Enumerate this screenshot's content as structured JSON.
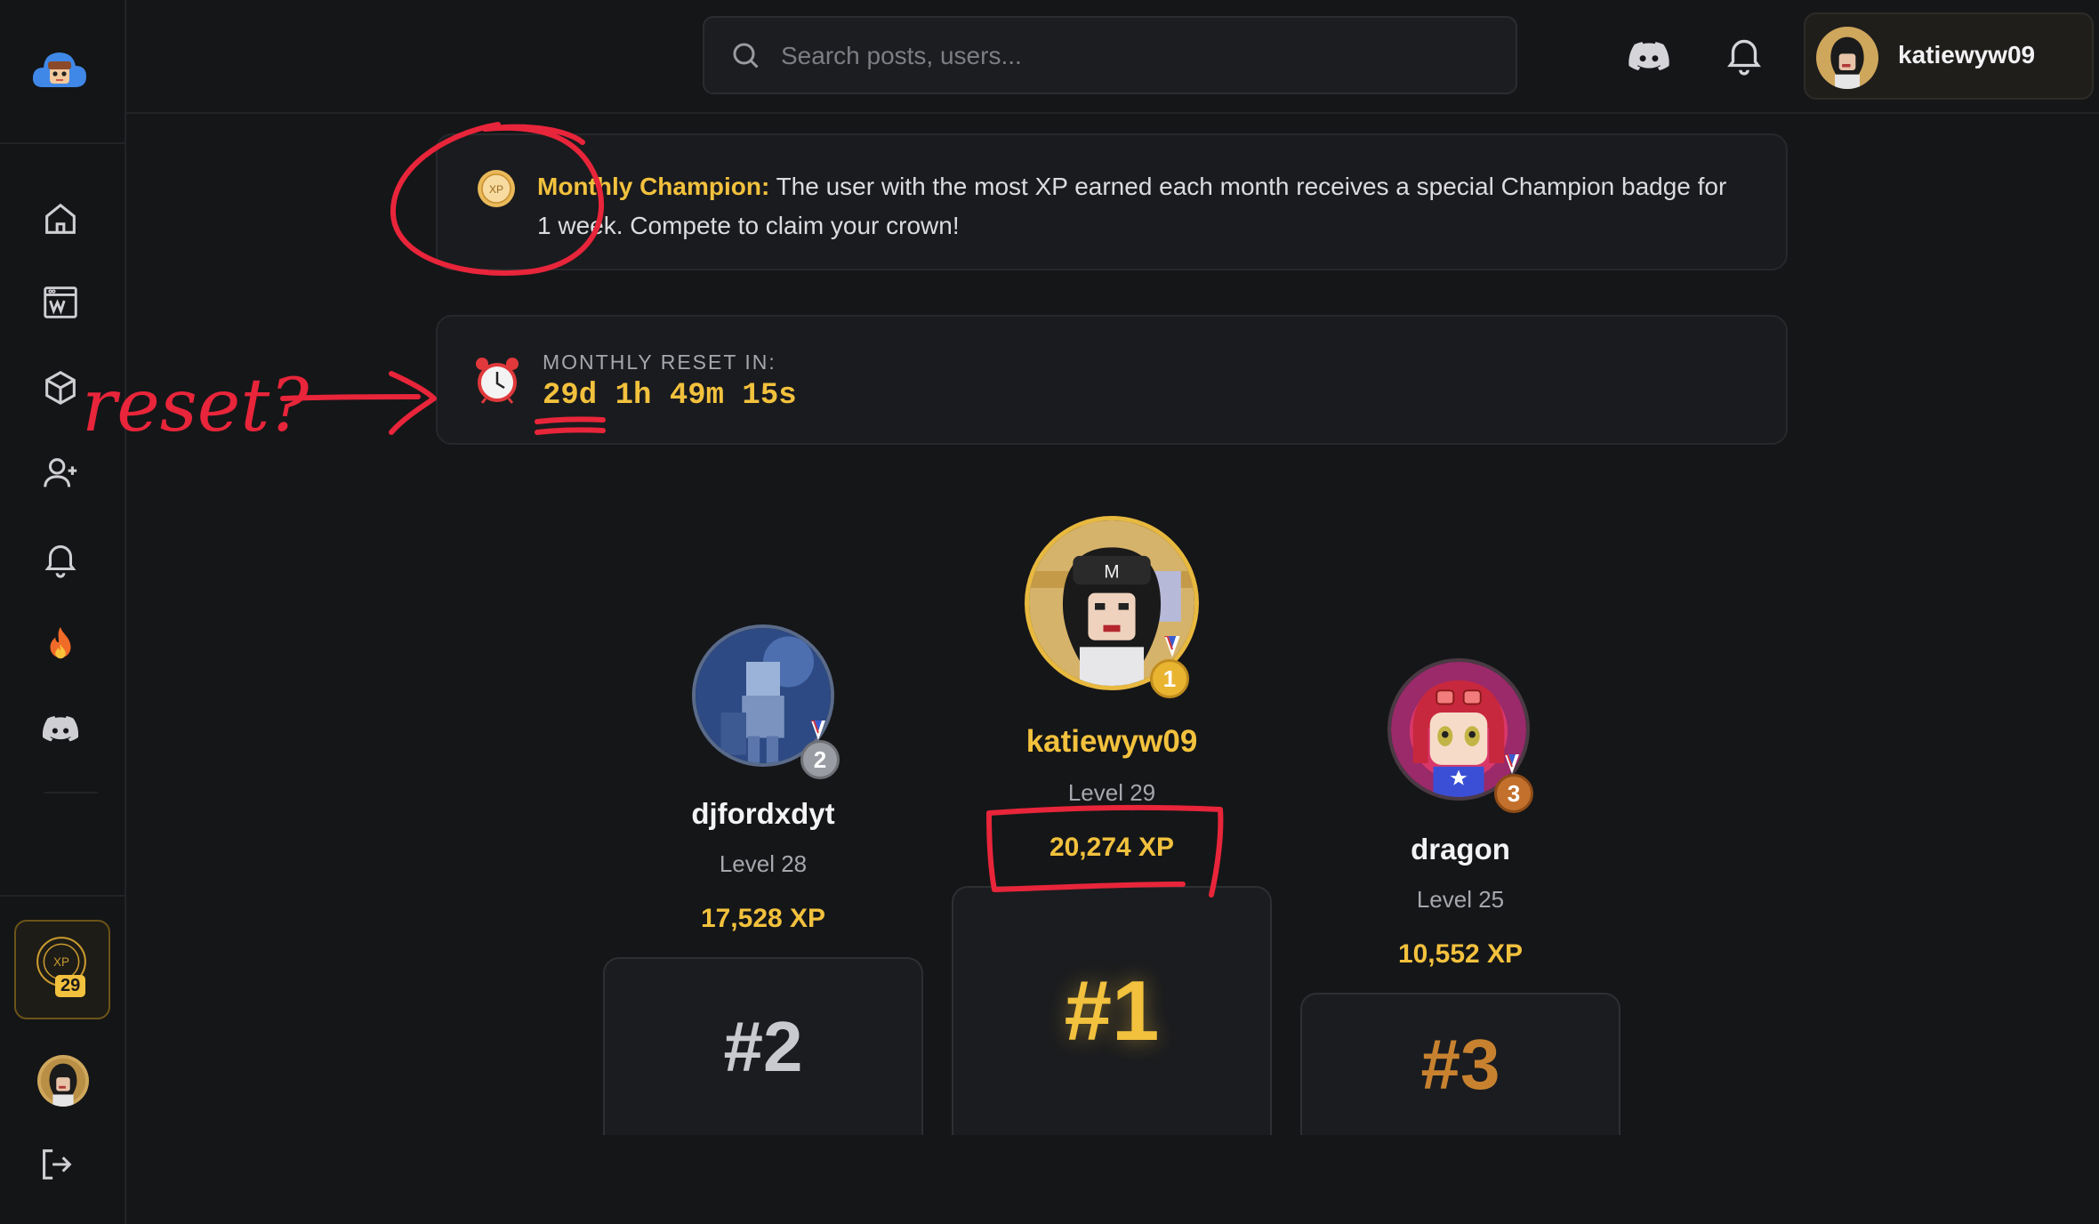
{
  "header": {
    "search_placeholder": "Search posts, users...",
    "username": "katiewyw09"
  },
  "sidebar": {
    "level_badge_label": "XP",
    "level": "29",
    "items": [
      {
        "icon": "home-icon"
      },
      {
        "icon": "wiki-icon"
      },
      {
        "icon": "cube-icon"
      },
      {
        "icon": "add-user-icon"
      },
      {
        "icon": "bell-icon"
      },
      {
        "icon": "fire-icon"
      },
      {
        "icon": "discord-icon"
      }
    ]
  },
  "champion": {
    "coin_label": "XP",
    "title": "Monthly Champion:",
    "body": " The user with the most XP earned each month receives a special Champion badge for 1 week. Compete to claim your crown!"
  },
  "reset": {
    "label": "MONTHLY RESET IN:",
    "time": "29d 1h 49m 15s"
  },
  "leaderboard": [
    {
      "rank": 2,
      "rank_label": "#2",
      "name": "djfordxdyt",
      "level": "Level 28",
      "xp": "17,528 XP",
      "color": "#c9cacf"
    },
    {
      "rank": 1,
      "rank_label": "#1",
      "name": "katiewyw09",
      "level": "Level 29",
      "xp": "20,274 XP",
      "color": "#f2c13d"
    },
    {
      "rank": 3,
      "rank_label": "#3",
      "name": "dragon",
      "level": "Level 25",
      "xp": "10,552 XP",
      "color": "#c8822f"
    }
  ],
  "annotations": {
    "handwritten_note": "reset?"
  },
  "colors": {
    "accent": "#f2c13d",
    "background": "#151618",
    "annotation": "#e8253a"
  }
}
